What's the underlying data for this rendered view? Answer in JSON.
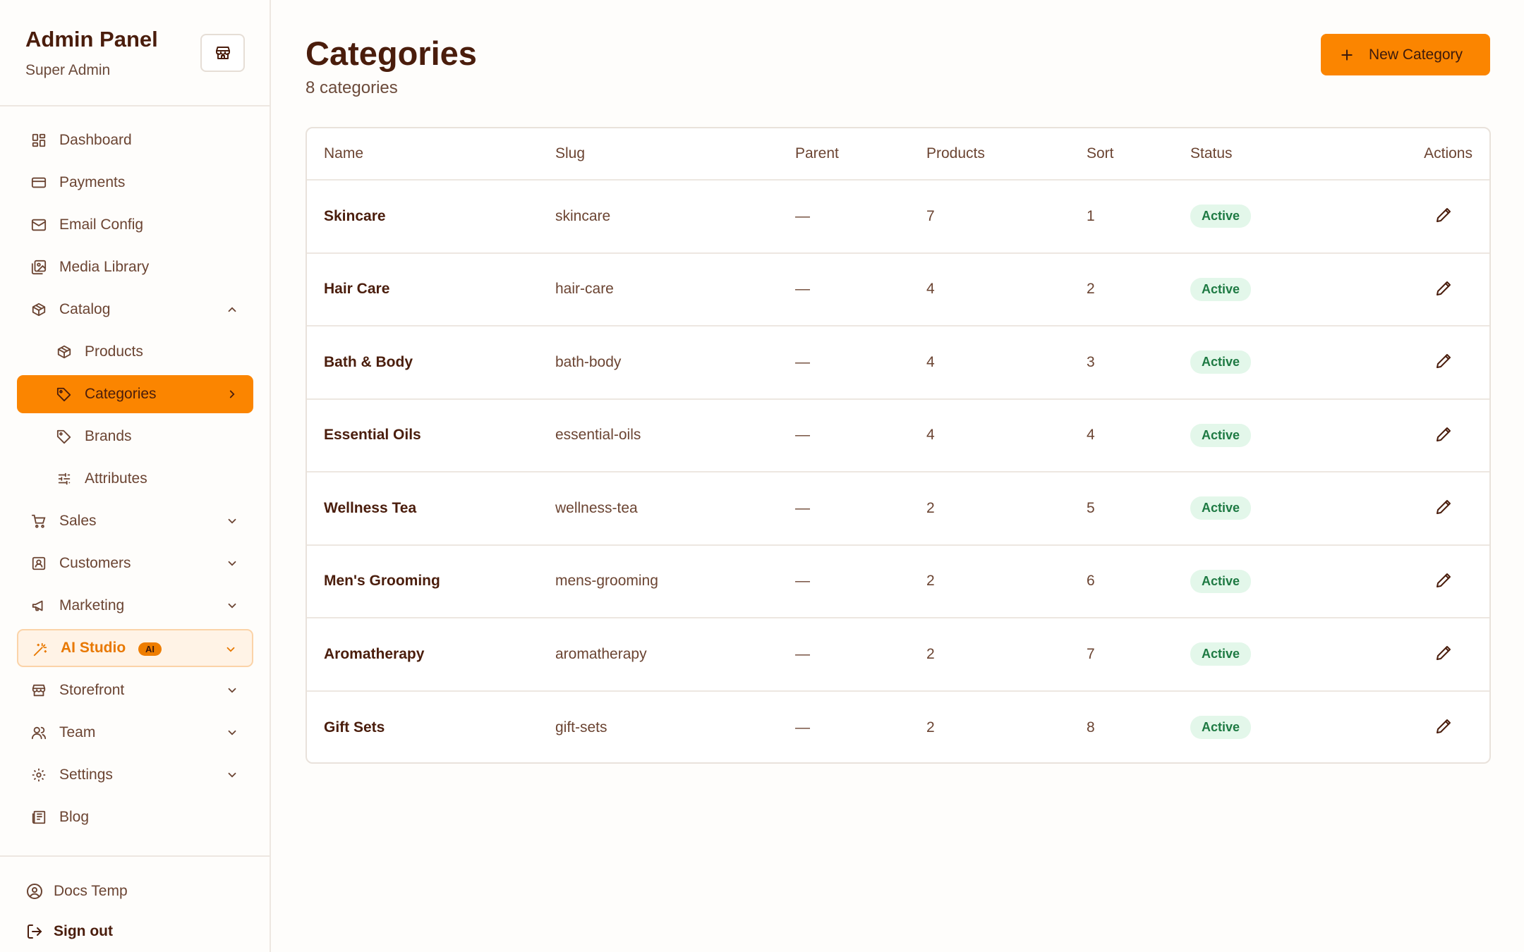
{
  "sidebar": {
    "title": "Admin Panel",
    "subtitle": "Super Admin",
    "items": [
      {
        "label": "Dashboard",
        "icon": "dashboard-icon"
      },
      {
        "label": "Payments",
        "icon": "credit-card-icon"
      },
      {
        "label": "Email Config",
        "icon": "mail-icon"
      },
      {
        "label": "Media Library",
        "icon": "image-icon"
      },
      {
        "label": "Catalog",
        "icon": "box-icon",
        "expanded": true
      },
      {
        "label": "Products",
        "icon": "box-icon"
      },
      {
        "label": "Categories",
        "icon": "tag-icon",
        "active": true
      },
      {
        "label": "Brands",
        "icon": "tag-icon"
      },
      {
        "label": "Attributes",
        "icon": "sliders-icon"
      },
      {
        "label": "Sales",
        "icon": "cart-icon"
      },
      {
        "label": "Customers",
        "icon": "contact-icon"
      },
      {
        "label": "Marketing",
        "icon": "megaphone-icon"
      },
      {
        "label": "AI Studio",
        "icon": "magic-wand-icon",
        "badge": "AI"
      },
      {
        "label": "Storefront",
        "icon": "store-icon"
      },
      {
        "label": "Team",
        "icon": "users-icon"
      },
      {
        "label": "Settings",
        "icon": "gear-icon"
      },
      {
        "label": "Blog",
        "icon": "newspaper-icon"
      }
    ],
    "footer": {
      "user": "Docs Temp",
      "signout": "Sign out"
    }
  },
  "page": {
    "title": "Categories",
    "count": "8 categories",
    "new_button": "New Category"
  },
  "table": {
    "headers": [
      "Name",
      "Slug",
      "Parent",
      "Products",
      "Sort",
      "Status",
      "Actions"
    ],
    "rows": [
      {
        "name": "Skincare",
        "slug": "skincare",
        "parent": "—",
        "products": "7",
        "sort": "1",
        "status": "Active"
      },
      {
        "name": "Hair Care",
        "slug": "hair-care",
        "parent": "—",
        "products": "4",
        "sort": "2",
        "status": "Active"
      },
      {
        "name": "Bath & Body",
        "slug": "bath-body",
        "parent": "—",
        "products": "4",
        "sort": "3",
        "status": "Active"
      },
      {
        "name": "Essential Oils",
        "slug": "essential-oils",
        "parent": "—",
        "products": "4",
        "sort": "4",
        "status": "Active"
      },
      {
        "name": "Wellness Tea",
        "slug": "wellness-tea",
        "parent": "—",
        "products": "2",
        "sort": "5",
        "status": "Active"
      },
      {
        "name": "Men's Grooming",
        "slug": "mens-grooming",
        "parent": "—",
        "products": "2",
        "sort": "6",
        "status": "Active"
      },
      {
        "name": "Aromatherapy",
        "slug": "aromatherapy",
        "parent": "—",
        "products": "2",
        "sort": "7",
        "status": "Active"
      },
      {
        "name": "Gift Sets",
        "slug": "gift-sets",
        "parent": "—",
        "products": "2",
        "sort": "8",
        "status": "Active"
      }
    ]
  },
  "colors": {
    "accent": "#fb8500",
    "text_dark": "#4a1d0c",
    "status_bg": "#e3f7ea",
    "status_text": "#1e7a43"
  }
}
